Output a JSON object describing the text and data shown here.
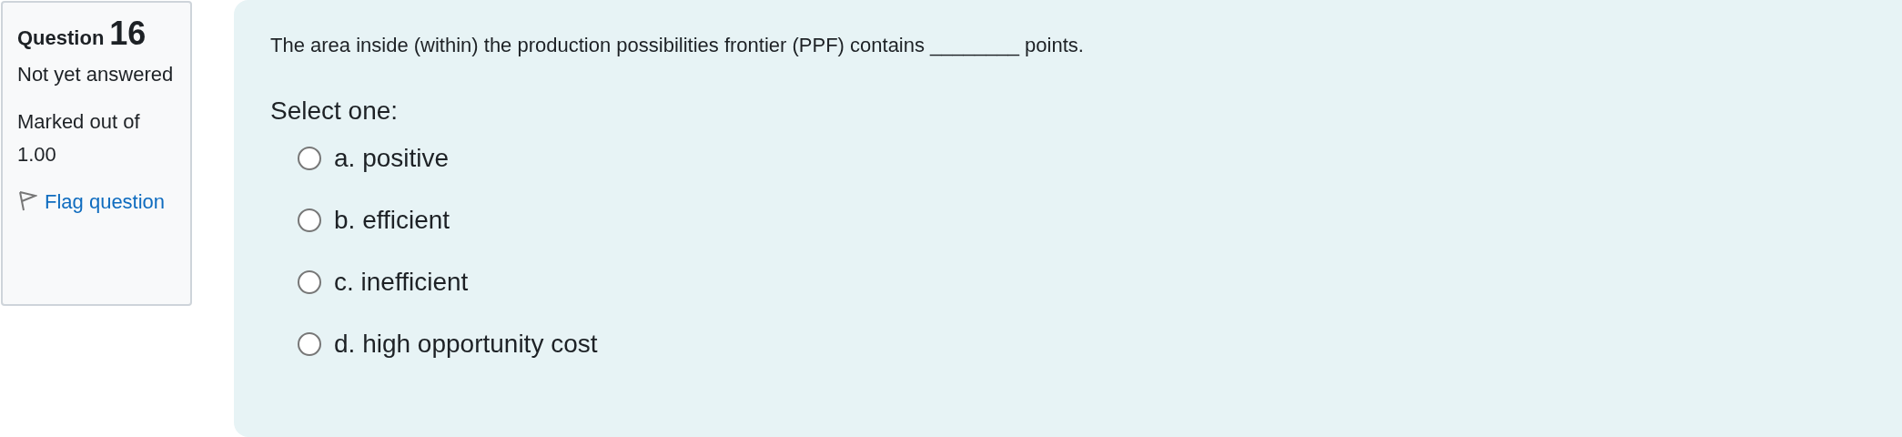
{
  "info": {
    "question_label": "Question",
    "question_number": "16",
    "status": "Not yet answered",
    "marks": "Marked out of 1.00",
    "flag_link": "Flag question"
  },
  "question": {
    "text": "The area inside (within) the production possibilities frontier (PPF) contains ________ points.",
    "prompt": "Select one:",
    "options": [
      {
        "label": "a. positive",
        "selected": false
      },
      {
        "label": "b. efficient",
        "selected": false
      },
      {
        "label": "c. inefficient",
        "selected": false
      },
      {
        "label": "d. high opportunity cost",
        "selected": false
      }
    ]
  }
}
